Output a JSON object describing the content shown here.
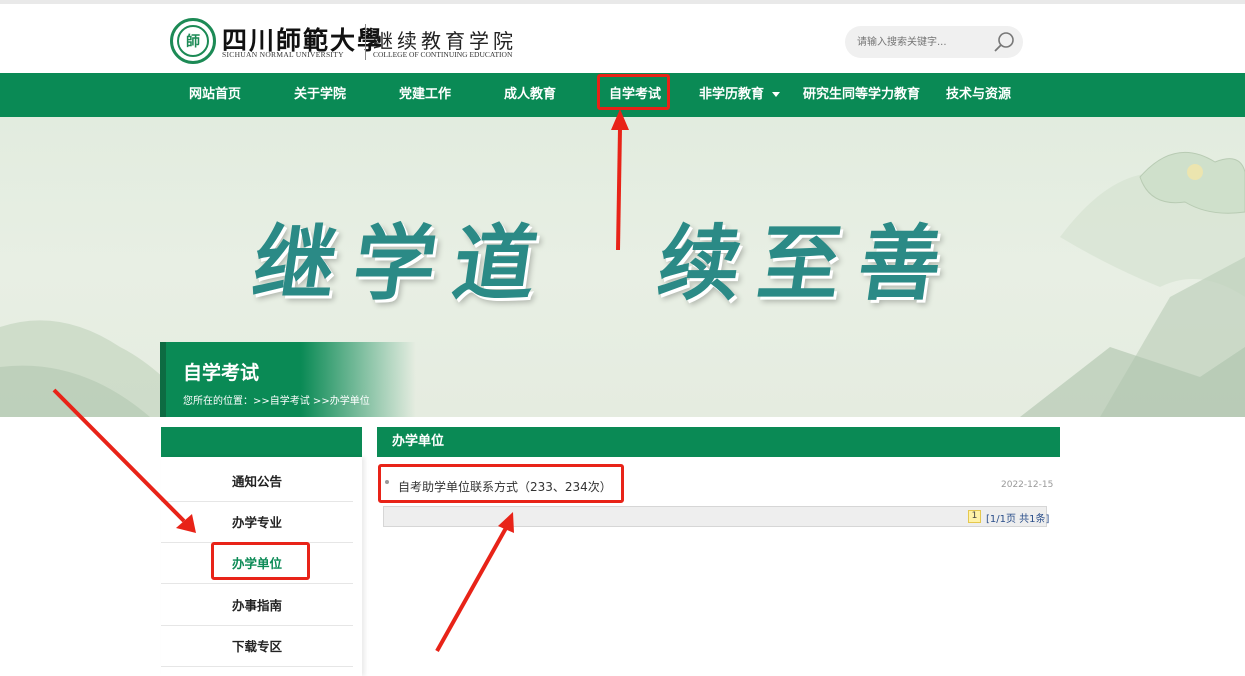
{
  "header": {
    "logo_cn": "四川師範大學",
    "logo_en": "SICHUAN NORMAL UNIVERSITY",
    "college_cn": "继续教育学院",
    "college_en": "COLLEGE OF CONTINUING EDUCATION",
    "seal_text": "師"
  },
  "search": {
    "placeholder": "请输入搜索关键字...",
    "icon": "search-icon"
  },
  "nav": {
    "items": [
      {
        "label": "网站首页"
      },
      {
        "label": "关于学院"
      },
      {
        "label": "党建工作"
      },
      {
        "label": "成人教育"
      },
      {
        "label": "自学考试"
      },
      {
        "label": "非学历教育"
      },
      {
        "label": "研究生同等学力教育"
      },
      {
        "label": "技术与资源"
      }
    ],
    "active_index": 4
  },
  "banner": {
    "calligraphy_left": "继学道",
    "calligraphy_right": "续至善",
    "section_title": "自学考试",
    "breadcrumb_prefix": "您所在的位置：",
    "breadcrumb_path": ">>自学考试 >>办学单位"
  },
  "sidebar": {
    "items": [
      {
        "label": "通知公告"
      },
      {
        "label": "办学专业"
      },
      {
        "label": "办学单位"
      },
      {
        "label": "办事指南"
      },
      {
        "label": "下载专区"
      }
    ],
    "active_index": 2
  },
  "main": {
    "title": "办学单位",
    "list": [
      {
        "title": "自考助学单位联系方式（233、234次）",
        "date": "2022-12-15"
      }
    ],
    "pager": {
      "current": "1",
      "info": "[1/1页 共1条]"
    }
  },
  "colors": {
    "brand_green": "#0a8a55",
    "annotation_red": "#e82318"
  }
}
